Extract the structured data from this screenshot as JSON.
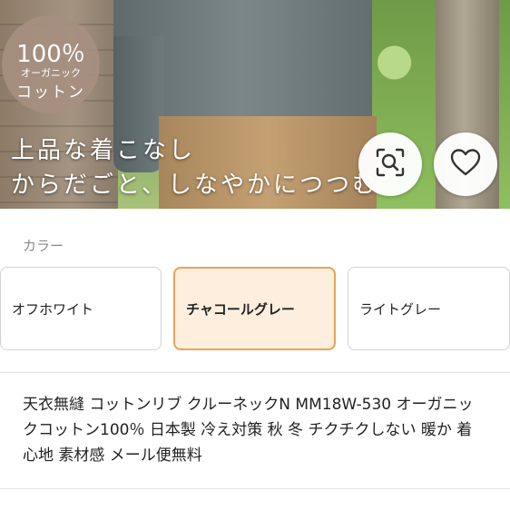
{
  "hero": {
    "badge": {
      "percent": "100％",
      "line1": "オーガニック",
      "line2": "コットン"
    },
    "caption_line1": "上品な着こなし",
    "caption_line2": "からだごと、しなやかにつつむ"
  },
  "actions": {
    "zoom_icon": "zoom-search-icon",
    "favorite_icon": "heart-icon"
  },
  "color_section": {
    "label": "カラー",
    "options": [
      {
        "label": "オフホワイト",
        "selected": false
      },
      {
        "label": "チャコールグレー",
        "selected": true
      },
      {
        "label": "ライトグレー",
        "selected": false
      }
    ],
    "selected_border_color": "#e8a35b",
    "selected_bg_color": "#fdeedd"
  },
  "product": {
    "title": "天衣無縫 コットンリブ クルーネックN MM18W-530 オーガニックコットン100％ 日本製 冷え対策 秋 冬 チクチクしない 暖か 着心地 素材感 メール便無料"
  }
}
